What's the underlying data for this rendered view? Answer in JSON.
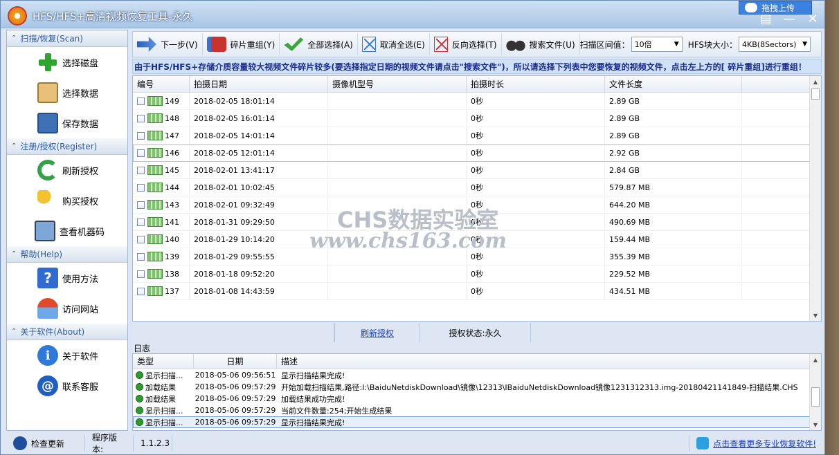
{
  "window": {
    "title": "HFS/HFS+高清视频恢复工具-永久",
    "baidu_label": "拖拽上传",
    "min": "—",
    "close": "✕",
    "menu": "▤"
  },
  "sidebar": {
    "groups": [
      {
        "head": "扫描/恢复(Scan)",
        "items": [
          "选择磁盘",
          "选择数据",
          "保存数据"
        ]
      },
      {
        "head": "注册/授权(Register)",
        "items": [
          "刷新授权",
          "购买授权",
          "查看机器码"
        ]
      },
      {
        "head": "帮助(Help)",
        "items": [
          "使用方法",
          "访问网站"
        ]
      },
      {
        "head": "关于软件(About)",
        "items": [
          "关于软件",
          "联系客服"
        ]
      }
    ]
  },
  "toolbar": {
    "next": "下一步(V)",
    "reassemble": "碎片重组(Y)",
    "select_all": "全部选择(A)",
    "deselect_all": "取消全选(E)",
    "invert": "反向选择(T)",
    "search": "搜索文件(U)",
    "interval_label": "扫描区间值：",
    "interval_value": "10倍",
    "block_label": "HFS块大小：",
    "block_value": "4KB(8Sectors)"
  },
  "notice": "由于HFS/HFS+存储介质容量较大视频文件碎片较多(要选择指定日期的视频文件请点击\"搜索文件\")，所以请选择下列表中您要恢复的视频文件，点击左上方的[ 碎片重组]进行重组！",
  "grid": {
    "headers": [
      "编号",
      "拍摄日期",
      "摄像机型号",
      "拍摄时长",
      "文件长度"
    ],
    "rows": [
      {
        "id": "149",
        "date": "2018-02-05 18:01:14",
        "model": "",
        "dur": "0秒",
        "size": "2.89 GB"
      },
      {
        "id": "148",
        "date": "2018-02-05 16:01:14",
        "model": "",
        "dur": "0秒",
        "size": "2.89 GB"
      },
      {
        "id": "147",
        "date": "2018-02-05 14:01:14",
        "model": "",
        "dur": "0秒",
        "size": "2.89 GB"
      },
      {
        "id": "146",
        "date": "2018-02-05 12:01:14",
        "model": "",
        "dur": "0秒",
        "size": "2.92 GB"
      },
      {
        "id": "145",
        "date": "2018-02-01 13:41:17",
        "model": "",
        "dur": "0秒",
        "size": "2.84 GB"
      },
      {
        "id": "144",
        "date": "2018-02-01 10:02:45",
        "model": "",
        "dur": "0秒",
        "size": "579.87 MB"
      },
      {
        "id": "143",
        "date": "2018-02-01 09:32:49",
        "model": "",
        "dur": "0秒",
        "size": "644.20 MB"
      },
      {
        "id": "141",
        "date": "2018-01-31 09:29:50",
        "model": "",
        "dur": "0秒",
        "size": "490.69 MB"
      },
      {
        "id": "140",
        "date": "2018-01-29 10:14:20",
        "model": "",
        "dur": "0秒",
        "size": "159.44 MB"
      },
      {
        "id": "139",
        "date": "2018-01-29 09:55:55",
        "model": "",
        "dur": "0秒",
        "size": "355.39 MB"
      },
      {
        "id": "138",
        "date": "2018-01-18 09:52:20",
        "model": "",
        "dur": "0秒",
        "size": "229.52 MB"
      },
      {
        "id": "137",
        "date": "2018-01-08 14:43:59",
        "model": "",
        "dur": "0秒",
        "size": "434.51 MB"
      }
    ]
  },
  "watermark": {
    "line1": "CHS数据实验室",
    "line2": "www.chs163.com"
  },
  "status": {
    "refresh_link": "刷新授权",
    "auth_state": "授权状态:永久"
  },
  "log": {
    "label": "日志",
    "headers": [
      "类型",
      "日期",
      "描述"
    ],
    "rows": [
      {
        "type": "显示扫描...",
        "date": "2018-05-06 09:56:51",
        "desc": "显示扫描结果完成!"
      },
      {
        "type": "加载结果",
        "date": "2018-05-06 09:57:29",
        "desc": "开始加载扫描结果,路径:I:\\BaiduNetdiskDownload\\镜像\\12313\\IBaiduNetdiskDownload镜像1231312313.img-20180421141849-扫描结果.CHS"
      },
      {
        "type": "加载结果",
        "date": "2018-05-06 09:57:29",
        "desc": "加载结果成功完成!"
      },
      {
        "type": "显示扫描...",
        "date": "2018-05-06 09:57:29",
        "desc": "当前文件数量:254;开始生成结果"
      },
      {
        "type": "显示扫描...",
        "date": "2018-05-06 09:57:29",
        "desc": "显示扫描结果完成!"
      }
    ]
  },
  "bottom": {
    "update": "检查更新",
    "version_label": "程序版本:",
    "version": "1.1.2.3",
    "more_link": "点击查看更多专业恢复软件!"
  }
}
